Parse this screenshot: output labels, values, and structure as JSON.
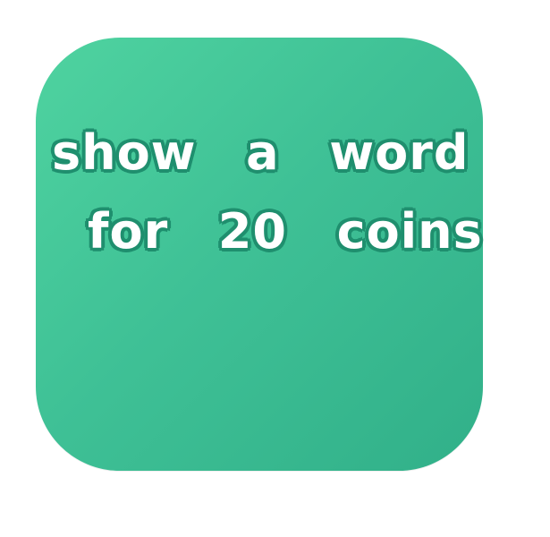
{
  "hint_button": {
    "line1": "show  a  word",
    "line2": "for  20  coins",
    "color": "#3fc196"
  }
}
